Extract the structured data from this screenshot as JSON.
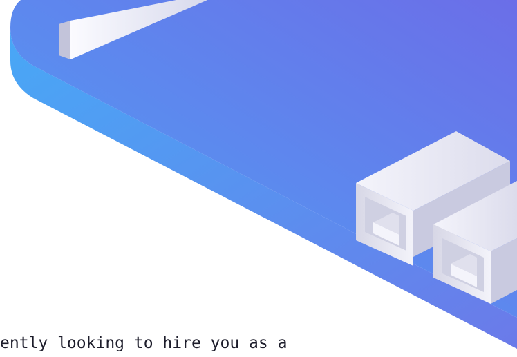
{
  "hero": {
    "illustration": "isometric-circuit-board-with-ports",
    "text": "ently looking to hire you as a"
  },
  "colors": {
    "board_gradient_start": "#4fa2f4",
    "board_gradient_end": "#6b6ee8",
    "board_edge": "#6d7aeb",
    "port_body": "#e9e9f5",
    "port_shadow": "#c9c9df",
    "text": "#1d1d2b"
  }
}
